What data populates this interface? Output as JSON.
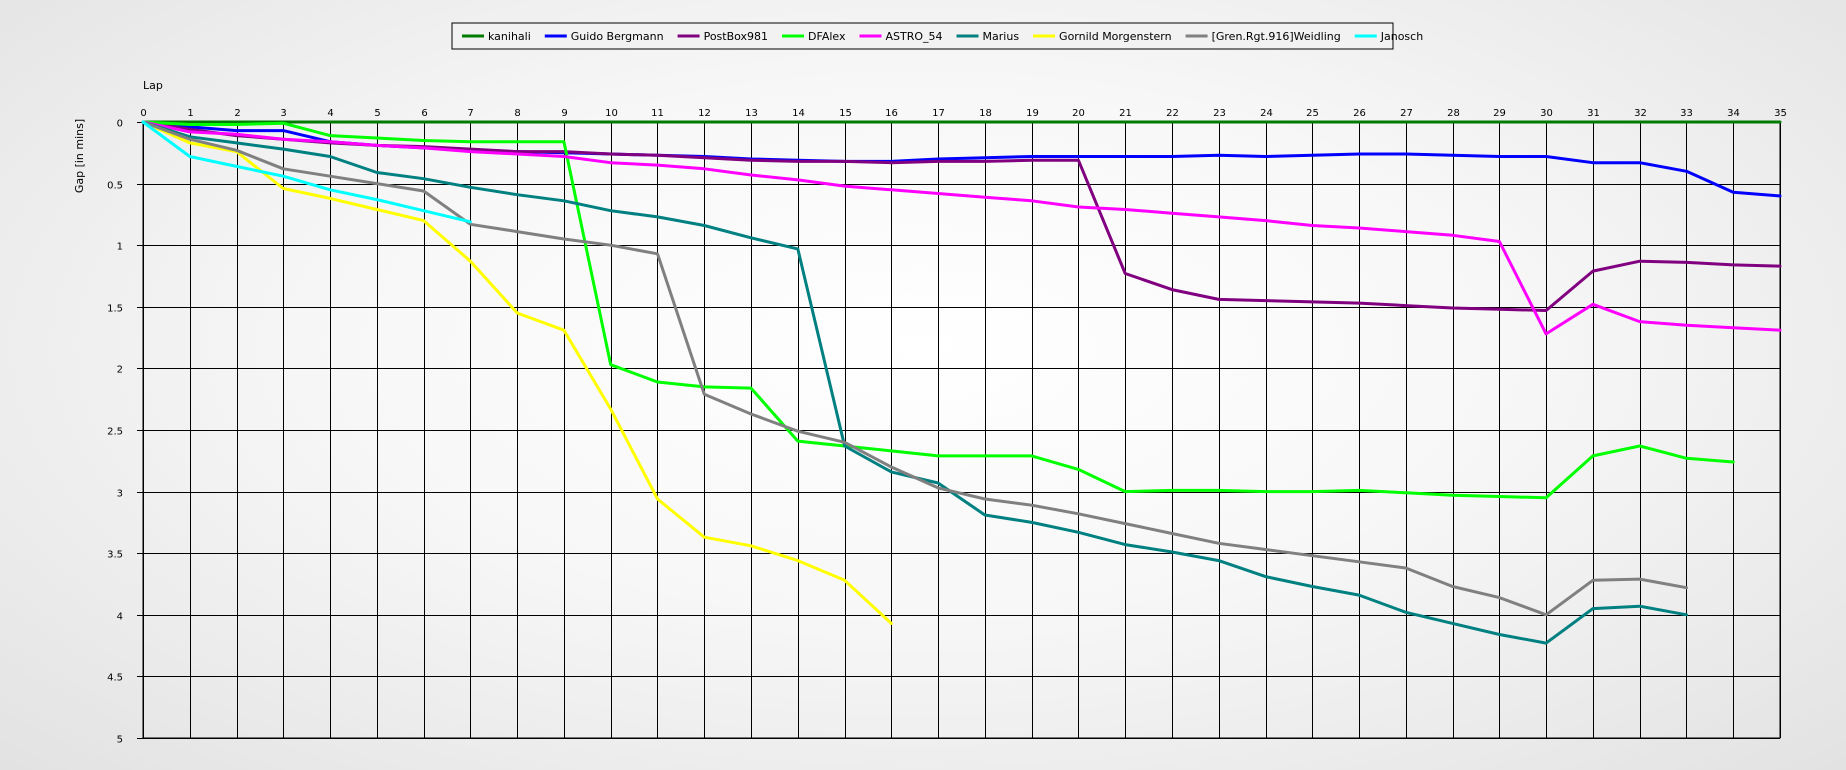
{
  "chart_data": {
    "type": "line",
    "xlabel": "Lap",
    "ylabel": "Gap [in mins]",
    "xlim": [
      0,
      35
    ],
    "ylim": [
      0,
      5
    ],
    "y_inverted": true,
    "x_ticks": [
      0,
      1,
      2,
      3,
      4,
      5,
      6,
      7,
      8,
      9,
      10,
      11,
      12,
      13,
      14,
      15,
      16,
      17,
      18,
      19,
      20,
      21,
      22,
      23,
      24,
      25,
      26,
      27,
      28,
      29,
      30,
      31,
      32,
      33,
      34,
      35
    ],
    "y_ticks": [
      {
        "value": 0,
        "label": "0"
      },
      {
        "value": 0.5,
        "label": "0.5"
      },
      {
        "value": 1,
        "label": "1"
      },
      {
        "value": 1.5,
        "label": "1.5"
      },
      {
        "value": 2,
        "label": "2"
      },
      {
        "value": 2.5,
        "label": "2.5"
      },
      {
        "value": 3,
        "label": "3"
      },
      {
        "value": 3.5,
        "label": "3.5"
      },
      {
        "value": 4,
        "label": "4"
      },
      {
        "value": 4.5,
        "label": "4.5"
      },
      {
        "value": 5,
        "label": "5"
      }
    ],
    "grid": true,
    "legend_position": "top",
    "series": [
      {
        "name": "kanihali",
        "color": "#007a00",
        "x": [
          0,
          1,
          2,
          3,
          4,
          5,
          6,
          7,
          8,
          9,
          10,
          11,
          12,
          13,
          14,
          15,
          16,
          17,
          18,
          19,
          20,
          21,
          22,
          23,
          24,
          25,
          26,
          27,
          28,
          29,
          30,
          31,
          32,
          33,
          34,
          35
        ],
        "y": [
          0,
          0,
          0,
          0,
          0,
          0,
          0,
          0,
          0,
          0,
          0,
          0,
          0,
          0,
          0,
          0,
          0,
          0,
          0,
          0,
          0,
          0,
          0,
          0,
          0,
          0,
          0,
          0,
          0,
          0,
          0,
          0,
          0,
          0,
          0,
          0
        ]
      },
      {
        "name": "Guido Bergmann",
        "color": "#0000ff",
        "x": [
          0,
          1,
          2,
          3,
          4,
          5,
          6,
          7,
          8,
          9,
          10,
          11,
          12,
          13,
          14,
          15,
          16,
          17,
          18,
          19,
          20,
          21,
          22,
          23,
          24,
          25,
          26,
          27,
          28,
          29,
          30,
          31,
          32,
          33,
          34,
          35
        ],
        "y": [
          0,
          0.04,
          0.07,
          0.07,
          0.16,
          0.19,
          0.21,
          0.23,
          0.24,
          0.25,
          0.26,
          0.27,
          0.28,
          0.3,
          0.31,
          0.32,
          0.32,
          0.3,
          0.29,
          0.28,
          0.28,
          0.28,
          0.28,
          0.27,
          0.28,
          0.27,
          0.26,
          0.26,
          0.27,
          0.28,
          0.28,
          0.33,
          0.33,
          0.4,
          0.57,
          0.6
        ]
      },
      {
        "name": "PostBox981",
        "color": "#800080",
        "x": [
          0,
          1,
          2,
          3,
          4,
          5,
          6,
          7,
          8,
          9,
          10,
          11,
          12,
          13,
          14,
          15,
          16,
          17,
          18,
          19,
          20,
          21,
          22,
          23,
          24,
          25,
          26,
          27,
          28,
          29,
          30,
          31,
          32,
          33,
          34,
          35
        ],
        "y": [
          0,
          0.06,
          0.11,
          0.14,
          0.17,
          0.19,
          0.2,
          0.22,
          0.24,
          0.24,
          0.26,
          0.27,
          0.29,
          0.31,
          0.32,
          0.32,
          0.33,
          0.32,
          0.32,
          0.31,
          0.31,
          1.23,
          1.36,
          1.44,
          1.45,
          1.46,
          1.47,
          1.49,
          1.51,
          1.52,
          1.53,
          1.21,
          1.13,
          1.14,
          1.16,
          1.17
        ]
      },
      {
        "name": "DFAlex",
        "color": "#00ff00",
        "x": [
          0,
          1,
          2,
          3,
          4,
          5,
          6,
          7,
          8,
          9,
          10,
          11,
          12,
          13,
          14,
          15,
          16,
          17,
          18,
          19,
          20,
          21,
          22,
          23,
          24,
          25,
          26,
          27,
          28,
          29,
          30,
          31,
          32,
          33,
          34
        ],
        "y": [
          0,
          0.02,
          0.02,
          0.01,
          0.11,
          0.13,
          0.15,
          0.16,
          0.16,
          0.16,
          1.97,
          2.11,
          2.15,
          2.16,
          2.59,
          2.63,
          2.67,
          2.71,
          2.71,
          2.71,
          2.82,
          3.0,
          2.99,
          2.99,
          3.0,
          3.0,
          2.99,
          3.01,
          3.03,
          3.04,
          3.05,
          2.71,
          2.63,
          2.73,
          2.76
        ]
      },
      {
        "name": "ASTRO_54",
        "color": "#ff00ff",
        "x": [
          0,
          1,
          2,
          3,
          4,
          5,
          6,
          7,
          8,
          9,
          10,
          11,
          12,
          13,
          14,
          15,
          16,
          17,
          18,
          19,
          20,
          21,
          22,
          23,
          24,
          25,
          26,
          27,
          28,
          29,
          30,
          31,
          32,
          33,
          34,
          35
        ],
        "y": [
          0,
          0.08,
          0.1,
          0.14,
          0.16,
          0.19,
          0.21,
          0.24,
          0.26,
          0.28,
          0.33,
          0.35,
          0.38,
          0.43,
          0.47,
          0.52,
          0.55,
          0.58,
          0.61,
          0.64,
          0.69,
          0.71,
          0.74,
          0.77,
          0.8,
          0.84,
          0.86,
          0.89,
          0.92,
          0.97,
          1.72,
          1.48,
          1.62,
          1.65,
          1.67,
          1.69
        ]
      },
      {
        "name": "Marius",
        "color": "#008080",
        "x": [
          0,
          1,
          2,
          3,
          4,
          5,
          6,
          7,
          8,
          9,
          10,
          11,
          12,
          13,
          14,
          15,
          16,
          17,
          18,
          19,
          20,
          21,
          22,
          23,
          24,
          25,
          26,
          27,
          28,
          29,
          30,
          31,
          32,
          33
        ],
        "y": [
          0,
          0.12,
          0.17,
          0.22,
          0.28,
          0.41,
          0.46,
          0.53,
          0.59,
          0.64,
          0.72,
          0.77,
          0.84,
          0.94,
          1.03,
          2.63,
          2.84,
          2.93,
          3.19,
          3.25,
          3.33,
          3.43,
          3.49,
          3.56,
          3.69,
          3.77,
          3.84,
          3.98,
          4.07,
          4.16,
          4.23,
          3.95,
          3.93,
          4.0
        ]
      },
      {
        "name": "Gornild Morgenstern",
        "color": "#ffff00",
        "x": [
          0,
          1,
          2,
          3,
          4,
          5,
          6,
          7,
          8,
          9,
          10,
          11,
          12,
          13,
          14,
          15,
          16
        ],
        "y": [
          0,
          0.17,
          0.24,
          0.54,
          0.62,
          0.71,
          0.8,
          1.13,
          1.55,
          1.69,
          2.33,
          3.06,
          3.37,
          3.44,
          3.56,
          3.72,
          4.07
        ]
      },
      {
        "name": "[Gren.Rgt.916]Weidling",
        "color": "#808080",
        "x": [
          0,
          1,
          2,
          3,
          4,
          5,
          6,
          7,
          8,
          9,
          10,
          11,
          12,
          13,
          14,
          15,
          16,
          17,
          18,
          19,
          20,
          21,
          22,
          23,
          24,
          25,
          26,
          27,
          28,
          29,
          30,
          31,
          32,
          33
        ],
        "y": [
          0,
          0.14,
          0.23,
          0.38,
          0.44,
          0.5,
          0.56,
          0.83,
          0.89,
          0.95,
          1.0,
          1.07,
          2.21,
          2.37,
          2.51,
          2.6,
          2.8,
          2.97,
          3.06,
          3.11,
          3.18,
          3.26,
          3.34,
          3.42,
          3.47,
          3.52,
          3.57,
          3.62,
          3.77,
          3.86,
          4.0,
          3.72,
          3.71,
          3.78
        ]
      },
      {
        "name": "Janosch",
        "color": "#00ffff",
        "x": [
          0,
          1,
          2,
          3,
          4,
          5,
          6,
          7
        ],
        "y": [
          0,
          0.28,
          0.36,
          0.44,
          0.55,
          0.63,
          0.72,
          0.81
        ]
      }
    ]
  }
}
